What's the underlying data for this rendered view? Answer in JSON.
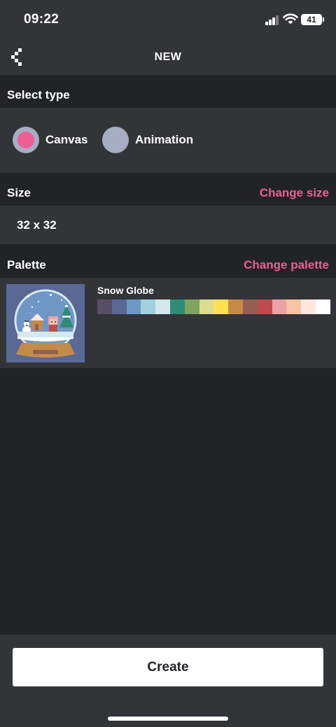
{
  "status_bar": {
    "time": "09:22",
    "battery": "41"
  },
  "header": {
    "title": "NEW",
    "back_icon": "chevron-left-pixel-icon"
  },
  "select_type": {
    "title": "Select type",
    "options": [
      {
        "label": "Canvas",
        "selected": true
      },
      {
        "label": "Animation",
        "selected": false
      }
    ]
  },
  "size": {
    "title": "Size",
    "change_label": "Change size",
    "value": "32 x 32"
  },
  "palette": {
    "title": "Palette",
    "change_label": "Change palette",
    "name": "Snow Globe",
    "colors": [
      "#574e64",
      "#5a6894",
      "#6f97c6",
      "#9fd2de",
      "#d5e8ec",
      "#2f8b74",
      "#7ea460",
      "#dadc8e",
      "#fde150",
      "#c48b47",
      "#935f55",
      "#c04b4f",
      "#eba1a5",
      "#fac4a4",
      "#fde7df",
      "#ffffff"
    ]
  },
  "footer": {
    "create_label": "Create"
  },
  "colors": {
    "accent": "#ef5e92",
    "background": "#222327",
    "panel": "#333438",
    "radio_off": "#a7adc2"
  }
}
